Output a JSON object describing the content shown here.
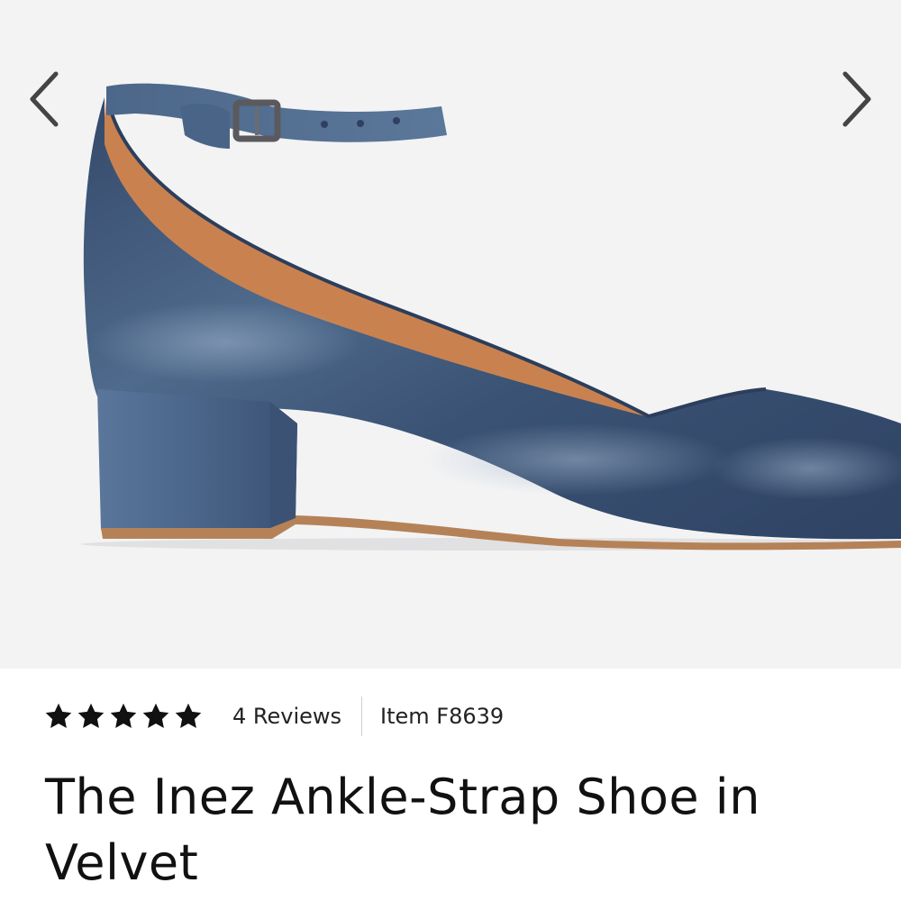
{
  "gallery": {
    "image_alt": "Blue velvet ankle-strap block-heel shoe",
    "prev_icon": "chevron-left-icon",
    "next_icon": "chevron-right-icon",
    "colors": {
      "background": "#f3f3f4",
      "velvet": "#3f5878",
      "lining": "#c9824f",
      "sole": "#b58257",
      "arrow": "#444444"
    }
  },
  "product": {
    "rating": 5,
    "rating_max": 5,
    "star_icon": "star-icon",
    "reviews_label": "4 Reviews",
    "item_number": "Item F8639",
    "title": "The Inez Ankle-Strap Shoe in Velvet"
  }
}
